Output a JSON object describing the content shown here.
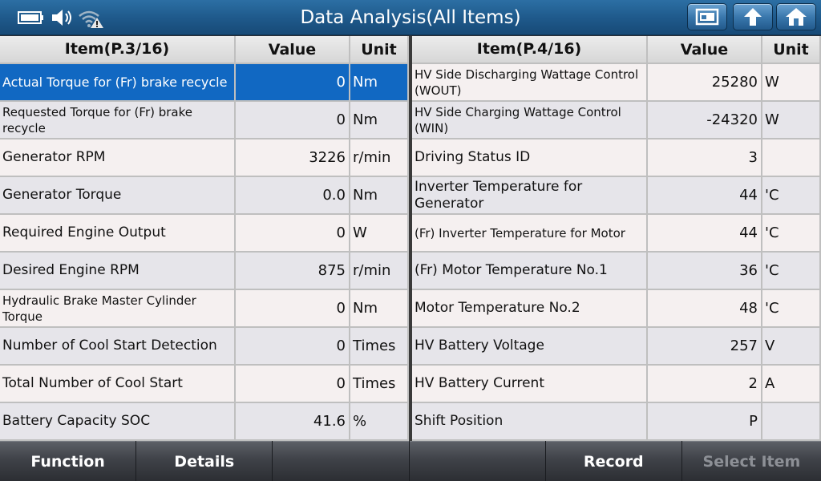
{
  "title": "Data Analysis(All Items)",
  "left": {
    "headers": {
      "item": "Item(P.3/16)",
      "value": "Value",
      "unit": "Unit"
    },
    "rows": [
      {
        "item": "Actual Torque for (Fr) brake recycle",
        "value": "0",
        "unit": "Nm",
        "selected": true
      },
      {
        "item": "Requested Torque for (Fr) brake recycle",
        "value": "0",
        "unit": "Nm"
      },
      {
        "item": "Generator RPM",
        "value": "3226",
        "unit": "r/min"
      },
      {
        "item": "Generator Torque",
        "value": "0.0",
        "unit": "Nm"
      },
      {
        "item": "Required Engine Output",
        "value": "0",
        "unit": "W"
      },
      {
        "item": "Desired Engine RPM",
        "value": "875",
        "unit": "r/min"
      },
      {
        "item": "Hydraulic Brake Master Cylinder Torque",
        "value": "0",
        "unit": "Nm"
      },
      {
        "item": "Number of Cool Start Detection",
        "value": "0",
        "unit": "Times"
      },
      {
        "item": "Total Number of Cool Start",
        "value": "0",
        "unit": "Times"
      },
      {
        "item": "Battery Capacity SOC",
        "value": "41.6",
        "unit": "%"
      }
    ]
  },
  "right": {
    "headers": {
      "item": "Item(P.4/16)",
      "value": "Value",
      "unit": "Unit"
    },
    "rows": [
      {
        "item": "HV Side Discharging Wattage Control (WOUT)",
        "value": "25280",
        "unit": "W"
      },
      {
        "item": "HV Side Charging Wattage Control (WIN)",
        "value": "-24320",
        "unit": "W"
      },
      {
        "item": "Driving Status ID",
        "value": "3",
        "unit": ""
      },
      {
        "item": "Inverter Temperature for Generator",
        "value": "44",
        "unit": "'C"
      },
      {
        "item": "(Fr) Inverter Temperature for Motor",
        "value": "44",
        "unit": "'C"
      },
      {
        "item": "(Fr) Motor Temperature No.1",
        "value": "36",
        "unit": "'C"
      },
      {
        "item": "Motor Temperature No.2",
        "value": "48",
        "unit": "'C"
      },
      {
        "item": "HV Battery Voltage",
        "value": "257",
        "unit": "V"
      },
      {
        "item": "HV Battery Current",
        "value": "2",
        "unit": "A"
      },
      {
        "item": "Shift Position",
        "value": "P",
        "unit": ""
      }
    ]
  },
  "bottom_buttons": [
    {
      "label": "Function",
      "enabled": true
    },
    {
      "label": "Details",
      "enabled": true
    },
    {
      "label": "",
      "enabled": true
    },
    {
      "label": "",
      "enabled": true
    },
    {
      "label": "Record",
      "enabled": true
    },
    {
      "label": "Select Item",
      "enabled": false
    }
  ],
  "icons": {
    "status": [
      "battery-icon",
      "speaker-icon",
      "wifi-warning-icon"
    ],
    "toolbar": [
      "screenshot-icon",
      "back-icon",
      "home-icon"
    ]
  },
  "colors": {
    "title_bar": "#1f5a8c",
    "selected_row": "#1168c2",
    "row_light": "#f5f0f0",
    "row_alt": "#e6e5ea",
    "bottom_bar": "#3f4248"
  }
}
